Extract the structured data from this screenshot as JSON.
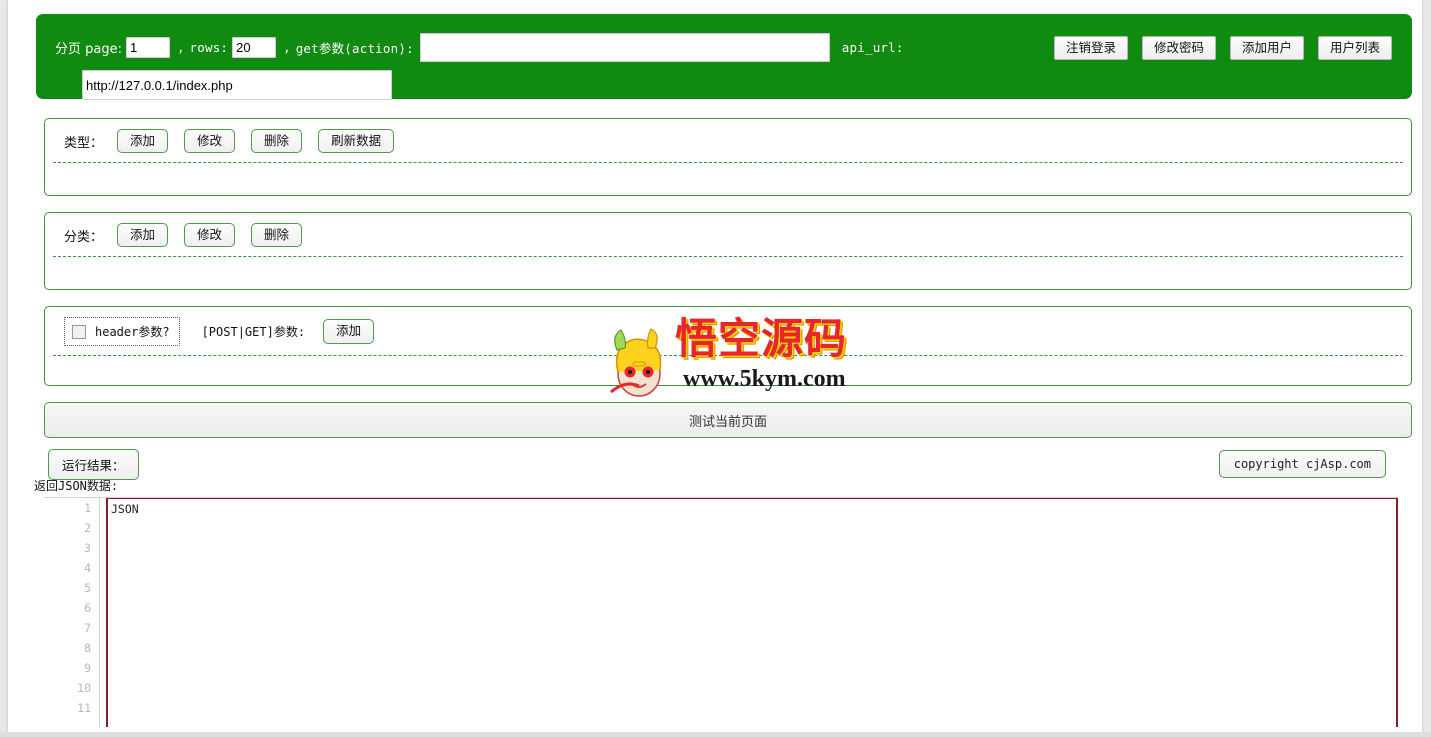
{
  "header": {
    "pagination_label": "分页 page:",
    "page_value": "1",
    "comma1": ",",
    "rows_label": "rows:",
    "rows_value": "20",
    "comma2": ",",
    "action_label": "get参数(action):",
    "action_value": "",
    "api_url_label": "api_url:",
    "api_url_value": "http://127.0.0.1/index.php",
    "buttons": [
      {
        "label": "注销登录",
        "name": "logout-button"
      },
      {
        "label": "修改密码",
        "name": "change-password-button"
      },
      {
        "label": "添加用户",
        "name": "add-user-button"
      },
      {
        "label": "用户列表",
        "name": "user-list-button"
      }
    ]
  },
  "type_section": {
    "label": "类型：",
    "buttons": [
      {
        "label": "添加",
        "name": "type-add-button"
      },
      {
        "label": "修改",
        "name": "type-edit-button"
      },
      {
        "label": "删除",
        "name": "type-delete-button"
      },
      {
        "label": "刷新数据",
        "name": "type-refresh-button"
      }
    ]
  },
  "category_section": {
    "label": "分类：",
    "buttons": [
      {
        "label": "添加",
        "name": "category-add-button"
      },
      {
        "label": "修改",
        "name": "category-edit-button"
      },
      {
        "label": "删除",
        "name": "category-delete-button"
      }
    ]
  },
  "params_section": {
    "header_checkbox_label": "header参数?",
    "post_get_label": "[POST|GET]参数:",
    "add_button_label": "添加"
  },
  "watermark": {
    "title": "悟空源码",
    "url": "www.5kym.com"
  },
  "test_bar": {
    "label": "测试当前页面"
  },
  "result": {
    "run_result_label": "运行结果：",
    "copyright": "copyright cjAsp.com",
    "json_data_label": "返回JSON数据:"
  },
  "editor": {
    "line_numbers": [
      "1",
      "2",
      "3",
      "4",
      "5",
      "6",
      "7",
      "8",
      "9",
      "10",
      "11"
    ],
    "lines": [
      "JSON",
      "",
      "",
      "",
      "",
      "",
      "",
      "",
      "",
      "",
      ""
    ]
  },
  "colors": {
    "header_green": "#108a10",
    "border_green": "#3f8f3f",
    "editor_red": "#8b1a2b",
    "watermark_red": "#e8252a",
    "page_background": "#e8e8e8"
  }
}
